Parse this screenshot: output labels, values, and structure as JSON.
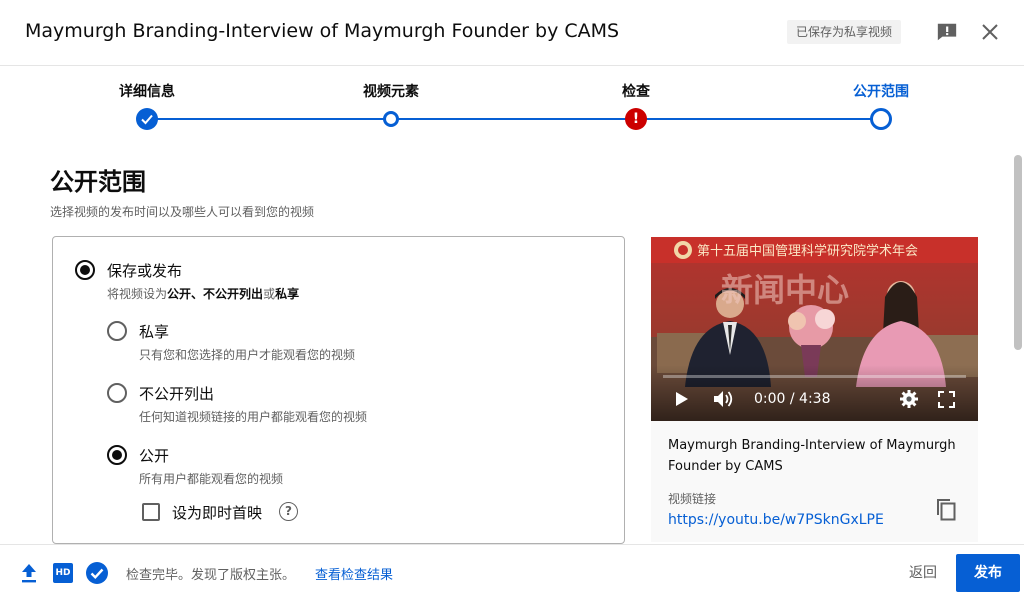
{
  "header": {
    "title": "Maymurgh Branding-Interview of Maymurgh Founder by CAMS",
    "saved_badge": "已保存为私享视频",
    "feedback_icon": "feedback-icon",
    "close_icon": "close-icon"
  },
  "stepper": {
    "steps": [
      {
        "label": "详细信息",
        "state": "done"
      },
      {
        "label": "视频元素",
        "state": "visited"
      },
      {
        "label": "检查",
        "state": "error"
      },
      {
        "label": "公开范围",
        "state": "current"
      }
    ],
    "error_glyph": "!"
  },
  "main": {
    "title": "公开范围",
    "description": "选择视频的发布时间以及哪些人可以看到您的视频",
    "save_or_publish": {
      "label": "保存或发布",
      "desc_parts": [
        "将视频设为",
        "公开",
        "、",
        "不公开列出",
        "或",
        "私享"
      ],
      "selected": true
    },
    "options": [
      {
        "label": "私享",
        "desc": "只有您和您选择的用户才能观看您的视频",
        "selected": false
      },
      {
        "label": "不公开列出",
        "desc": "任何知道视频链接的用户都能观看您的视频",
        "selected": false
      },
      {
        "label": "公开",
        "desc": "所有用户都能观看您的视频",
        "selected": true
      }
    ],
    "premiere": {
      "label": "设为即时首映",
      "checked": false,
      "help_glyph": "?"
    }
  },
  "video": {
    "banner_text": "第十五届中国管理科学研究院学术年会",
    "backdrop_text": "新闻中心",
    "time": "0:00 / 4:38",
    "progress": 0,
    "title": "Maymurgh Branding-Interview of Maymurgh Founder by CAMS",
    "link_label": "视频链接",
    "link": "https://youtu.be/w7PSknGxLPE"
  },
  "footer": {
    "hd_label": "HD",
    "status": "检查完毕。发现了版权主张。",
    "link": "查看检查结果",
    "back": "返回",
    "publish": "发布"
  },
  "colors": {
    "accent": "#065fd4",
    "error": "#cc0000",
    "text": "#0d0d0d",
    "muted": "#606060"
  }
}
